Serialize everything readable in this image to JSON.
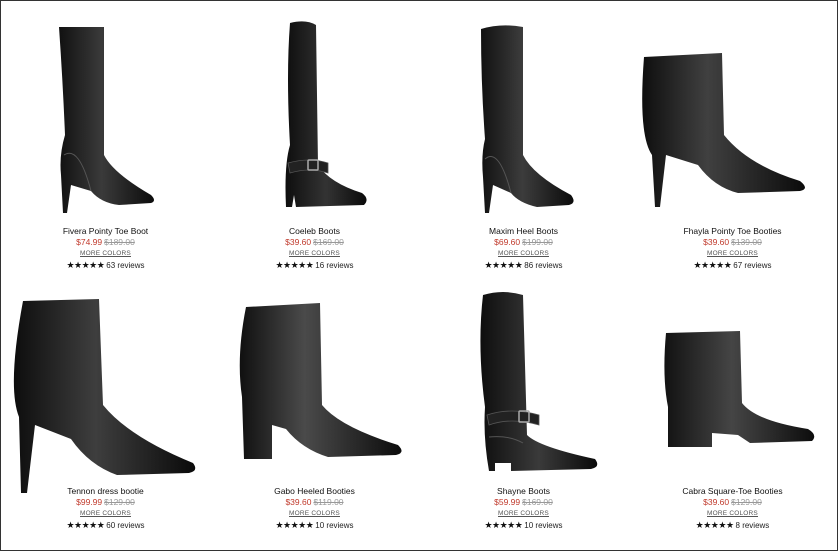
{
  "products": [
    {
      "name": "Fivera Pointy Toe Boot",
      "sale_price": "$74.99",
      "original_price": "$189.00",
      "more_colors": "MORE COLORS",
      "stars": "★★★★★",
      "reviews": "63 reviews"
    },
    {
      "name": "Coeleb Boots",
      "sale_price": "$39.60",
      "original_price": "$169.00",
      "more_colors": "MORE COLORS",
      "stars": "★★★★★",
      "reviews": "16 reviews"
    },
    {
      "name": "Maxim Heel Boots",
      "sale_price": "$69.60",
      "original_price": "$199.00",
      "more_colors": "MORE COLORS",
      "stars": "★★★★★",
      "reviews": "86 reviews"
    },
    {
      "name": "Fhayla Pointy Toe Booties",
      "sale_price": "$39.60",
      "original_price": "$139.00",
      "more_colors": "MORE COLORS",
      "stars": "★★★★★",
      "reviews": "67 reviews"
    },
    {
      "name": "Tennon dress bootie",
      "sale_price": "$99.99",
      "original_price": "$129.00",
      "more_colors": "MORE COLORS",
      "stars": "★★★★★",
      "reviews": "60 reviews"
    },
    {
      "name": "Gabo Heeled Booties",
      "sale_price": "$39.60",
      "original_price": "$119.00",
      "more_colors": "MORE COLORS",
      "stars": "★★★★★",
      "reviews": "10 reviews"
    },
    {
      "name": "Shayne Boots",
      "sale_price": "$59.99",
      "original_price": "$169.00",
      "more_colors": "MORE COLORS",
      "stars": "★★★★★",
      "reviews": "10 reviews"
    },
    {
      "name": "Cabra Square-Toe Booties",
      "sale_price": "$39.60",
      "original_price": "$129.00",
      "more_colors": "MORE COLORS",
      "stars": "★★★★★",
      "reviews": "8 reviews"
    }
  ],
  "colors": {
    "sale": "#c0392b",
    "original": "#999999",
    "boot": "#1a1a1a"
  }
}
